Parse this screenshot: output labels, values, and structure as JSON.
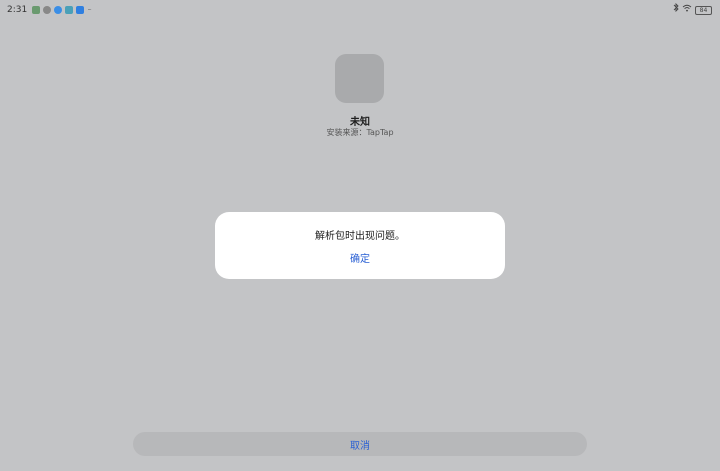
{
  "status_bar": {
    "time": "2:31",
    "notification_icons": [
      {
        "name": "app-notification-icon-1",
        "color": "#6a9a6f"
      },
      {
        "name": "app-notification-icon-2",
        "color": "#888888"
      },
      {
        "name": "app-notification-icon-3",
        "color": "#3a8ee6"
      },
      {
        "name": "app-notification-icon-4",
        "color": "#4aa0b8"
      },
      {
        "name": "app-notification-icon-5",
        "color": "#2f7fe0"
      }
    ],
    "more_indicator": "···",
    "bluetooth_icon": "bluetooth-icon",
    "wifi_icon": "wifi-icon",
    "battery_level": "84"
  },
  "app": {
    "name": "未知",
    "install_source": "安装来源：TapTap"
  },
  "dialog": {
    "message": "解析包时出现问题。",
    "confirm_label": "确定"
  },
  "bottom": {
    "cancel_label": "取消"
  },
  "colors": {
    "background": "#c3c4c6",
    "accent": "#2a60d4",
    "dialog_bg": "#ffffff"
  }
}
